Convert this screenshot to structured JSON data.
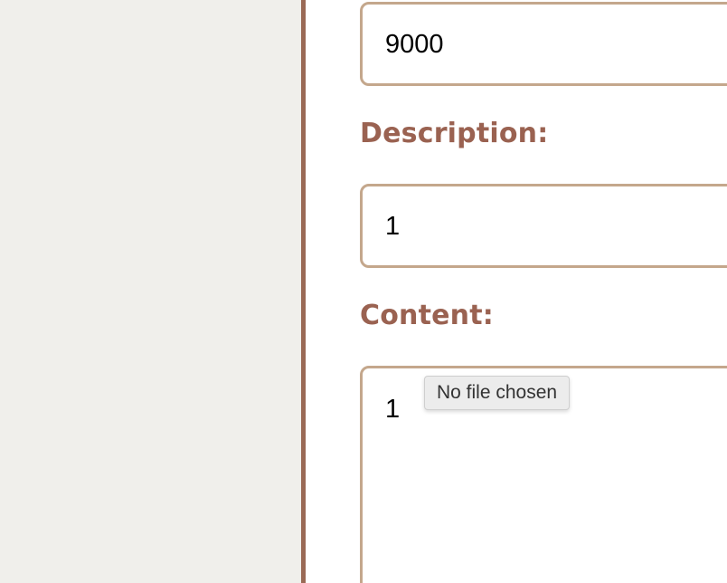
{
  "form": {
    "price_field": {
      "value": "9000"
    },
    "description_field": {
      "label": "Description:",
      "value": "1"
    },
    "content_field": {
      "label": "Content:",
      "value": "1",
      "file_status": "No file chosen"
    }
  },
  "colors": {
    "background": "#f0efeb",
    "divider": "#9a6a55",
    "input_border": "#c4a78c",
    "label_text": "#9a6251",
    "tooltip_bg": "#ececec"
  }
}
